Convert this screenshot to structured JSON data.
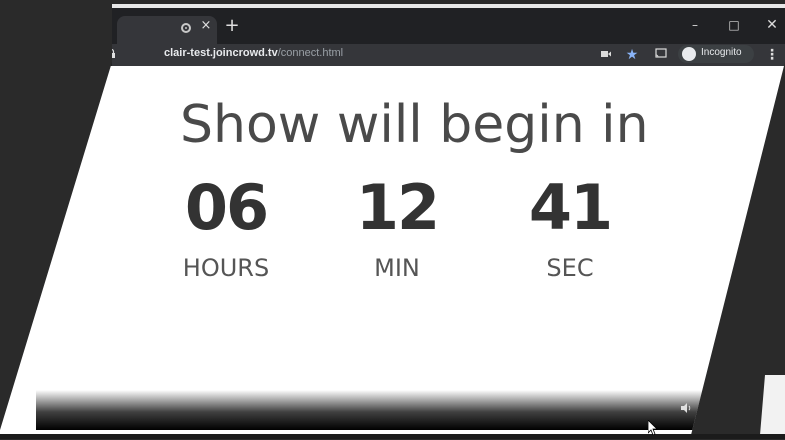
{
  "browser": {
    "tab": {
      "close_glyph": "×"
    },
    "new_tab_glyph": "+",
    "window_controls": {
      "minimize": "–",
      "maximize": "□",
      "close": "✕"
    },
    "address": {
      "host": "clair-test.joincrowd.tv",
      "path": "/connect.html"
    },
    "incognito_label": "Incognito",
    "icons": [
      "lock-icon",
      "camera-icon",
      "star-icon",
      "cast-icon",
      "incognito-icon",
      "menu-icon"
    ]
  },
  "page": {
    "headline": "Show will begin in",
    "countdown": [
      {
        "value": "06",
        "label": "HOURS"
      },
      {
        "value": "12",
        "label": "MIN"
      },
      {
        "value": "41",
        "label": "SEC"
      }
    ]
  },
  "colors": {
    "chrome_dark": "#202124",
    "toolbar": "#35363a",
    "star_blue": "#8ab4f8",
    "countdown_text": "#333333"
  }
}
